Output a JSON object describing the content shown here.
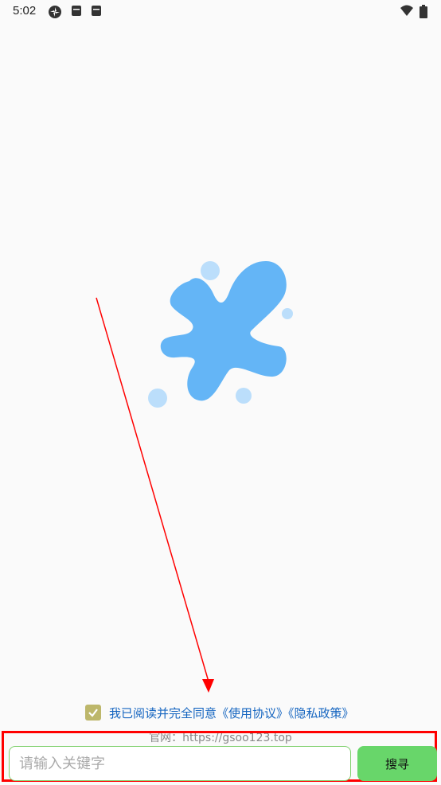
{
  "status_bar": {
    "time": "5:02",
    "icons": [
      "settings-gear-icon",
      "notification-icon",
      "notification-icon",
      "wifi-icon",
      "battery-icon"
    ]
  },
  "agreement": {
    "text": "我已阅读并完全同意",
    "user_agreement_link": "《使用协议》",
    "privacy_policy_link": "《隐私政策》",
    "checked": true
  },
  "website": {
    "text": "官网：https://gsoo123.top"
  },
  "search": {
    "placeholder": "请输入关键字",
    "button_label": "搜寻"
  },
  "colors": {
    "background": "#fafafa",
    "logo_blue": "#64b5f6",
    "logo_light_blue": "#bbdefb",
    "link_blue": "#1565c0",
    "checkbox": "#bdb76b",
    "button_green": "#68d66a",
    "input_border": "#7dcf6a",
    "annotation_red": "#ff0000"
  }
}
